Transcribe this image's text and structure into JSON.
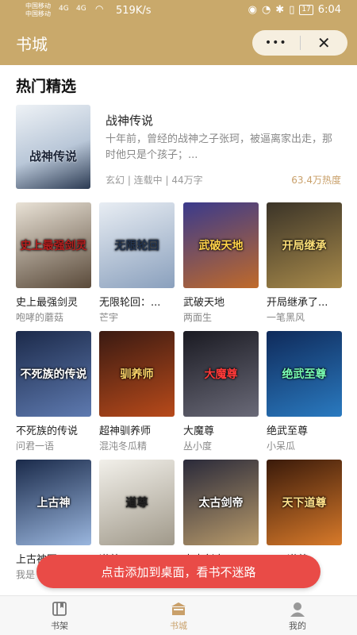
{
  "status_bar": {
    "carrier1": "中国移动",
    "carrier2": "中国移动",
    "sig1": "4G",
    "sig2": "4G",
    "speed": "519K/s",
    "battery": "17",
    "time": "6:04"
  },
  "header": {
    "title": "书城",
    "more_label": "•••",
    "close_label": "✕"
  },
  "section": {
    "title": "热门精选"
  },
  "featured": {
    "cover_text": "战神传说",
    "title": "战神传说",
    "description": "十年前，曾经的战神之子张珂，被逼离家出走，那时他只是个孩子；...",
    "meta": "玄幻 | 连载中 | 44万字",
    "heat": "63.4万热度"
  },
  "books": [
    {
      "cover_text": "史上最强剑灵",
      "title": "史上最强剑灵",
      "author": "咆哮的蘑菇",
      "c1": "#e9e2d6",
      "c2": "#5a4a3a",
      "tc": "#b51f1f"
    },
    {
      "cover_text": "无限轮回",
      "title": "无限轮回：...",
      "author": "芒宇",
      "c1": "#e8edf3",
      "c2": "#8aa0bd",
      "tc": "#23344f"
    },
    {
      "cover_text": "武破天地",
      "title": "武破天地",
      "author": "两面生",
      "c1": "#3a3a8c",
      "c2": "#c06a2a",
      "tc": "#ffd24a"
    },
    {
      "cover_text": "开局继承",
      "title": "开局继承了...",
      "author": "一笔黑风",
      "c1": "#3b3428",
      "c2": "#a88a4a",
      "tc": "#ffe27a"
    },
    {
      "cover_text": "不死族的传说",
      "title": "不死族的传说",
      "author": "问君一语",
      "c1": "#1c2a4a",
      "c2": "#5e7ab0",
      "tc": "#ffffff"
    },
    {
      "cover_text": "驯养师",
      "title": "超神驯养师",
      "author": "混沌冬瓜精",
      "c1": "#3a1a12",
      "c2": "#b84a1a",
      "tc": "#ffd76a"
    },
    {
      "cover_text": "大魔尊",
      "title": "大魔尊",
      "author": "丛小度",
      "c1": "#1a1a22",
      "c2": "#6a6a78",
      "tc": "#ff3a3a"
    },
    {
      "cover_text": "绝武至尊",
      "title": "绝武至尊",
      "author": "小呆瓜",
      "c1": "#0f2a5a",
      "c2": "#2a7ac0",
      "tc": "#7affb5"
    },
    {
      "cover_text": "上古神",
      "title": "上古神园",
      "author": "我是",
      "c1": "#1a2a4a",
      "c2": "#9ab6de",
      "tc": "#ffffff"
    },
    {
      "cover_text": "道尊",
      "title": "道尊",
      "author": "",
      "c1": "#f2f0ea",
      "c2": "#a0998a",
      "tc": "#222222"
    },
    {
      "cover_text": "太古剑帝",
      "title": "太古剑帝",
      "author": "",
      "c1": "#2a2a3a",
      "c2": "#b89a6a",
      "tc": "#ffffff"
    },
    {
      "cover_text": "天下道尊",
      "title": "天下道尊",
      "author": "",
      "c1": "#3a1a0a",
      "c2": "#d87a2a",
      "tc": "#ffe08a"
    }
  ],
  "toast": {
    "text": "点击添加到桌面，看书不迷路"
  },
  "tabs": [
    {
      "label": "书架"
    },
    {
      "label": "书城"
    },
    {
      "label": "我的"
    }
  ],
  "colors": {
    "brand": "#c9a96b",
    "toast": "#e94b47",
    "accent_text": "#c9a06a"
  }
}
